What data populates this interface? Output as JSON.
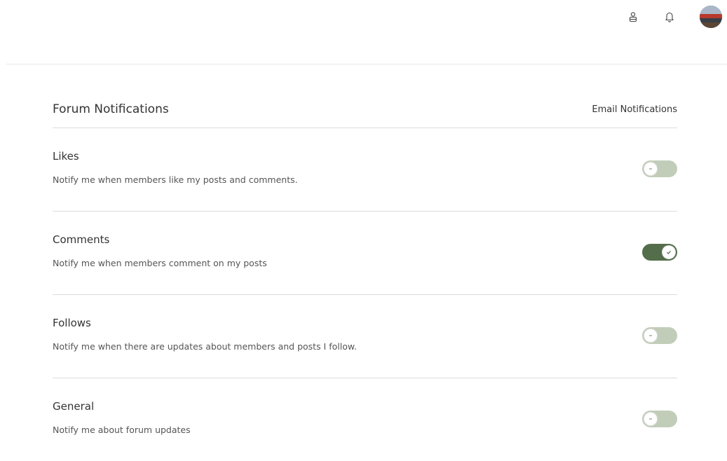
{
  "header": {
    "members_icon": "members-icon",
    "notifications_icon": "bell-icon",
    "avatar_icon": "user-avatar"
  },
  "panel": {
    "title": "Forum Notifications",
    "column_label": "Email Notifications",
    "items": [
      {
        "title": "Likes",
        "description": "Notify me when members like my posts and comments.",
        "enabled": false
      },
      {
        "title": "Comments",
        "description": "Notify me when members comment on my posts",
        "enabled": true
      },
      {
        "title": "Follows",
        "description": "Notify me when there are updates about members and posts I follow.",
        "enabled": false
      },
      {
        "title": "General",
        "description": "Notify me about forum updates",
        "enabled": false
      }
    ]
  },
  "colors": {
    "toggle_on": "#546d4a",
    "toggle_off": "#c2cdb9"
  }
}
